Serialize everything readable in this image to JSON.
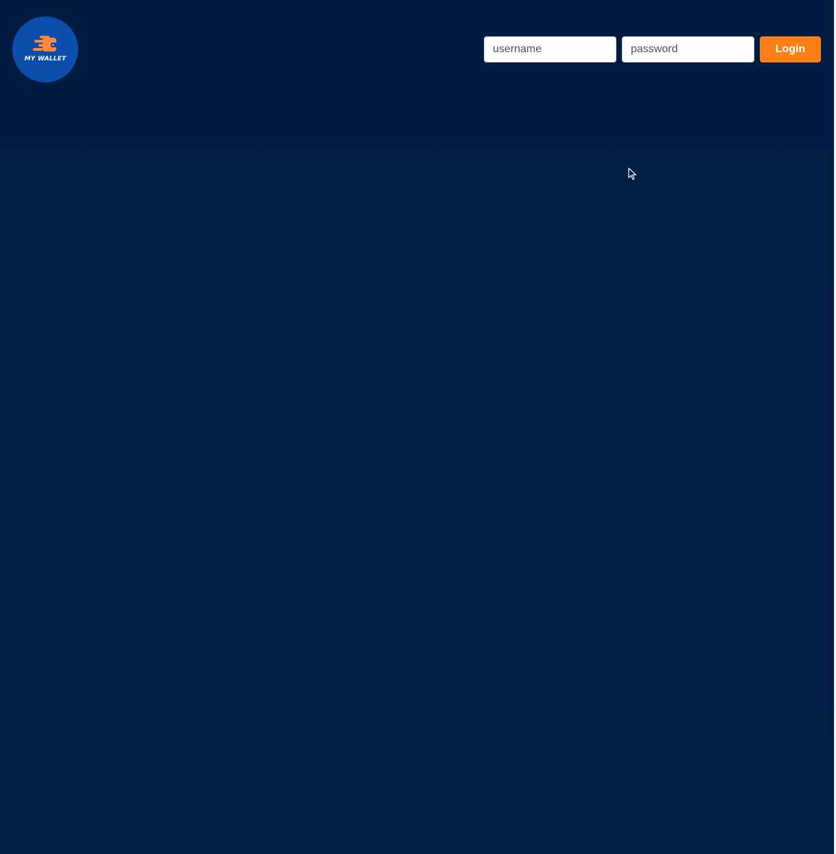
{
  "logo": {
    "text": "MY WALLET",
    "icon": "wallet-icon",
    "background": "#0b4eae",
    "accent": "#ff8a3d"
  },
  "login": {
    "username_placeholder": "username",
    "username_value": "",
    "password_placeholder": "password",
    "password_value": "",
    "button_label": "Login",
    "button_color": "#fd7e14"
  },
  "theme": {
    "background": "#001d42"
  },
  "cursor": {
    "icon": "mouse-pointer-icon"
  }
}
